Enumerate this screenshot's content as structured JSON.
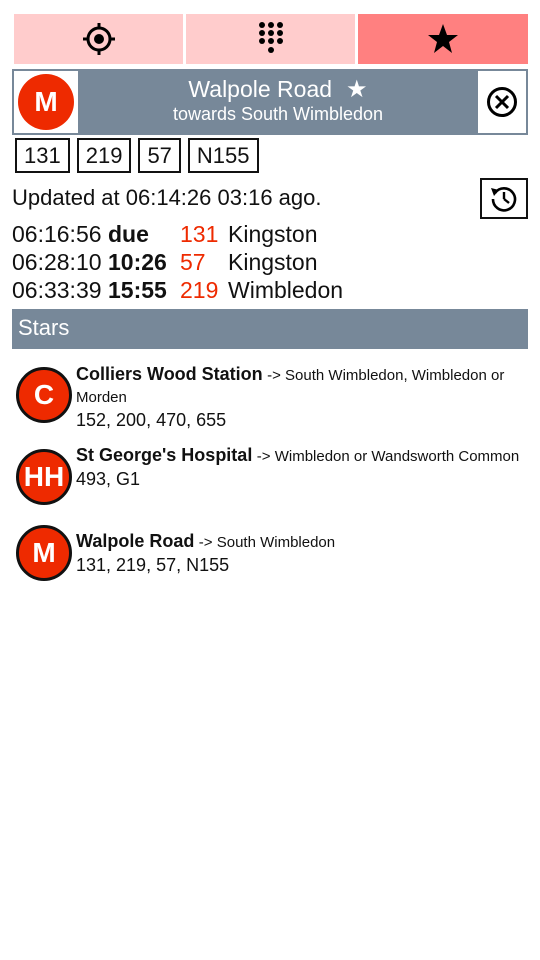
{
  "tabs": [
    {
      "icon": "crosshair-icon"
    },
    {
      "icon": "keypad-icon"
    },
    {
      "icon": "star-icon"
    }
  ],
  "current_stop": {
    "letter": "M",
    "name": "Walpole Road",
    "star_glyph": "★",
    "towards": "towards South Wimbledon",
    "routes": [
      "131",
      "219",
      "57",
      "N155"
    ]
  },
  "updated": {
    "text": "Updated at 06:14:26 03:16 ago."
  },
  "departures": [
    {
      "time": "06:16:56",
      "due": "due",
      "route": "131",
      "destination": "Kingston"
    },
    {
      "time": "06:28:10",
      "due": "10:26",
      "route": "57",
      "destination": "Kingston"
    },
    {
      "time": "06:33:39",
      "due": "15:55",
      "route": "219",
      "destination": "Wimbledon"
    }
  ],
  "stars": {
    "title": "Stars",
    "items": [
      {
        "letter": "C",
        "name": "Colliers Wood Station",
        "direction": "-> South Wimbledon, Wimbledon or Morden",
        "routes": "152, 200, 470, 655"
      },
      {
        "letter": "HH",
        "name": "St George's Hospital",
        "direction": "-> Wimbledon or Wandsworth Common",
        "routes": "493, G1"
      },
      {
        "letter": "M",
        "name": "Walpole Road",
        "direction": "-> South Wimbledon",
        "routes": "131, 219, 57, N155"
      }
    ]
  },
  "colors": {
    "tab_light": "#ffcccc",
    "tab_active": "#ff8080",
    "header_bg": "#778899",
    "stop_red": "#ee2a00"
  }
}
